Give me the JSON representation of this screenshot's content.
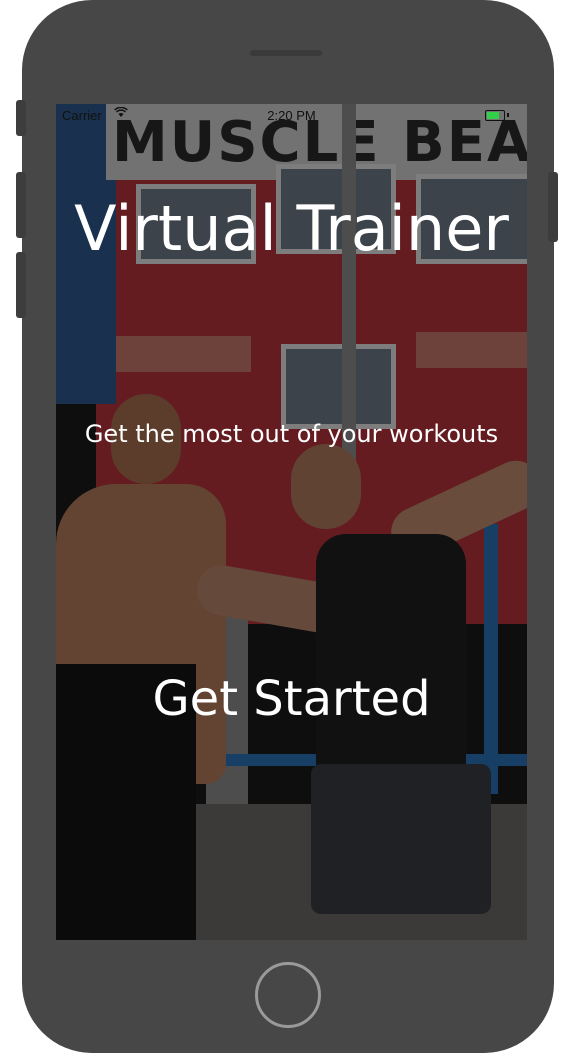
{
  "status_bar": {
    "carrier": "Carrier",
    "time": "2:20 PM",
    "battery_color": "#32d04a"
  },
  "background": {
    "sign_text": "MUSCLE BEACH"
  },
  "main": {
    "title": "Virtual Trainer",
    "subtitle": "Get the most out of your workouts",
    "cta_label": "Get Started"
  },
  "icons": {
    "wifi": "wifi-icon",
    "battery": "battery-icon",
    "home": "home-button-icon"
  }
}
